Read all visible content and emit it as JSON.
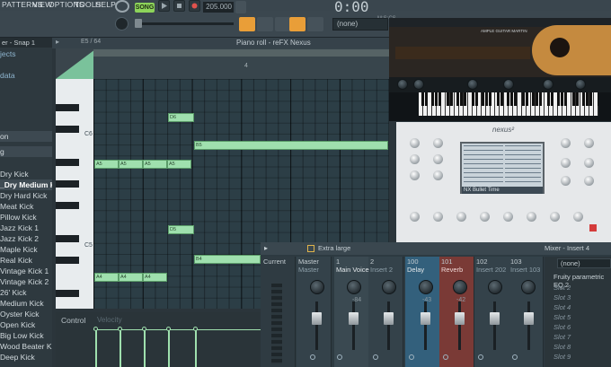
{
  "menu": [
    "PATTERNS",
    "VIEW",
    "OPTIONS",
    "TOOLS",
    "HELP"
  ],
  "transport": {
    "song_mode": "SONG",
    "tempo": "205.000",
    "time": "0:00",
    "time_unit": "M:S:CS",
    "pattern": "(none)"
  },
  "browser": {
    "header": "er - Snap 1",
    "items": [
      "jects",
      "data",
      "",
      "",
      "",
      "",
      "on",
      "g",
      "Dry Kick",
      "_Dry Medium Kick",
      "Dry Hard Kick",
      "Meat Kick",
      "Pillow Kick",
      "Jazz Kick 1",
      "Jazz Kick 2",
      "Maple Kick",
      "Real Kick",
      "Vintage Kick 1",
      "Vintage Kick 2",
      "26' Kick",
      "Medium Kick",
      "Oyster Kick",
      "Open Kick",
      "Big Low Kick",
      "Wood Beater Kick",
      "Deep Kick"
    ]
  },
  "piano_roll": {
    "title": "Piano roll - reFX Nexus",
    "position": "E5 / 64",
    "ruler_bar": "4",
    "octave_labels": [
      "C6",
      "C5"
    ],
    "notes": [
      {
        "label": "D6"
      },
      {
        "label": "B5"
      },
      {
        "label": "A5"
      },
      {
        "label": "A5"
      },
      {
        "label": "A5"
      },
      {
        "label": "A5"
      },
      {
        "label": "D5"
      },
      {
        "label": "B4"
      },
      {
        "label": "A4"
      },
      {
        "label": "A4"
      },
      {
        "label": "A4"
      }
    ],
    "control_label": "Control",
    "control_sub": "Velocity"
  },
  "plugins": {
    "ample_title": "AMPLE GUITAR MARTIN",
    "nexus_title": "nexus²",
    "nexus_preset": "NX Bullet Time"
  },
  "mixer": {
    "zoom": "Extra large",
    "title": "Mixer - Insert 4",
    "insert_select": "(none)",
    "strips": [
      {
        "num": "Current",
        "name": ""
      },
      {
        "num": "Master",
        "name": "Master"
      },
      {
        "num": "1",
        "name": "Main Voice"
      },
      {
        "num": "2",
        "name": "Insert 2"
      },
      {
        "num": "100",
        "name": "Delay"
      },
      {
        "num": "101",
        "name": "Reverb"
      },
      {
        "num": "102",
        "name": "Insert 202"
      },
      {
        "num": "103",
        "name": "Insert 103"
      }
    ],
    "strip_db": [
      "-84",
      "-43",
      "-42"
    ],
    "slots": [
      "Fruity parametric EQ 2",
      "Slot 2",
      "Slot 3",
      "Slot 4",
      "Slot 5",
      "Slot 6",
      "Slot 7",
      "Slot 8",
      "Slot 9"
    ]
  }
}
